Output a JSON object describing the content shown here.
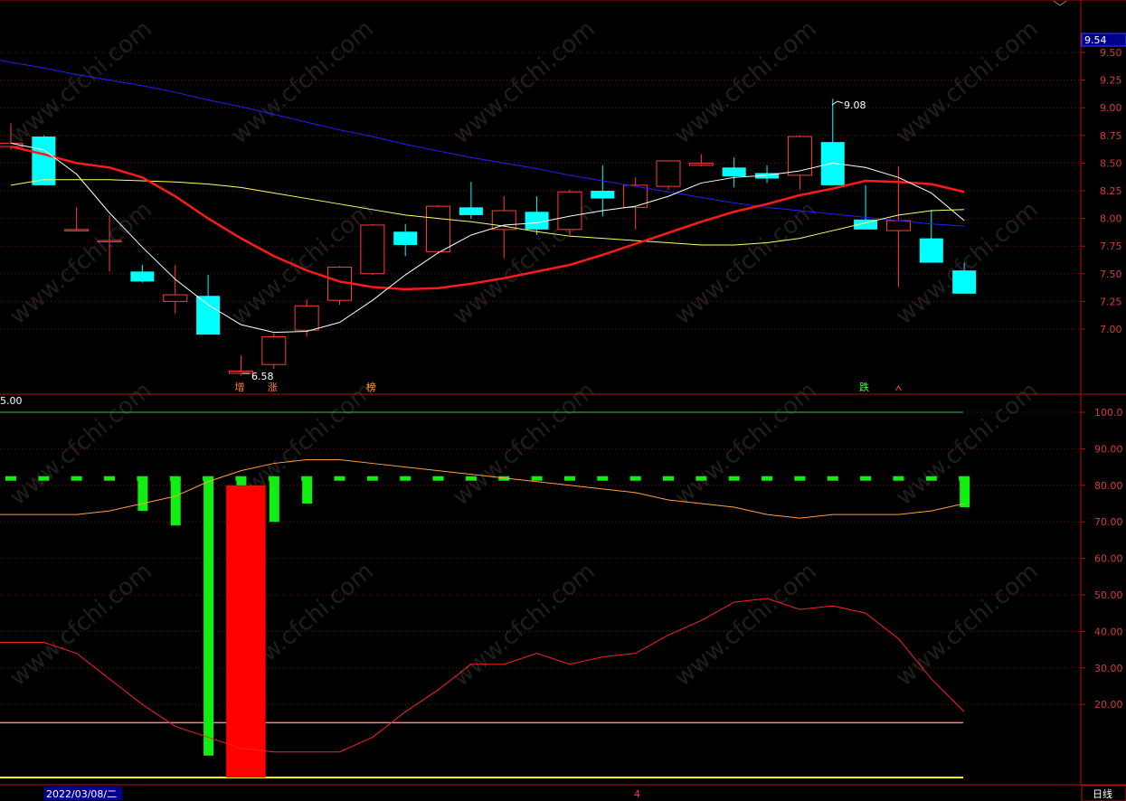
{
  "colors": {
    "background": "#000000",
    "axis": "#b01010",
    "grid": "#7a1010",
    "up": "#ff3c3c",
    "down": "#00ffff",
    "ma_short": "#ffffff",
    "ma_mid": "#ff1a1a",
    "ma_long": "#ffff66",
    "ma_longest": "#2020ff",
    "green_bar": "#11ee11",
    "red_bar": "#ff0000",
    "orange_line": "#ffa040",
    "red_line": "#ff2020",
    "ref_line_pink": "#ff8080",
    "ref_line_yellow": "#ffff00",
    "ref_line_green": "#3cbc3c",
    "price_tag_bg": "#00008b"
  },
  "header": {
    "price_tag": "9.54",
    "left_label": "5.00"
  },
  "footer": {
    "date_label": "2022/03/08/二",
    "center_marker": "4",
    "period_label": "日线"
  },
  "annotations": {
    "high_label": "9.08",
    "low_label": "6.58"
  },
  "chart_data": [
    {
      "type": "candlestick",
      "ylim": [
        6.7,
        9.6
      ],
      "yticks": [
        "9.50",
        "9.25",
        "9.00",
        "8.75",
        "8.50",
        "8.25",
        "8.00",
        "7.75",
        "7.50",
        "7.25",
        "7.00"
      ],
      "ytick_values": [
        9.5,
        9.25,
        9.0,
        8.75,
        8.5,
        8.25,
        8.0,
        7.75,
        7.5,
        7.25,
        7.0
      ],
      "candles": [
        {
          "o": 8.65,
          "h": 8.86,
          "l": 8.62,
          "c": 8.68
        },
        {
          "o": 8.74,
          "h": 8.75,
          "l": 8.3,
          "c": 8.3
        },
        {
          "o": 7.9,
          "h": 8.1,
          "l": 7.88,
          "c": 7.9
        },
        {
          "o": 7.8,
          "h": 8.03,
          "l": 7.52,
          "c": 7.8
        },
        {
          "o": 7.52,
          "h": 7.58,
          "l": 7.42,
          "c": 7.43
        },
        {
          "o": 7.25,
          "h": 7.58,
          "l": 7.14,
          "c": 7.31
        },
        {
          "o": 7.3,
          "h": 7.49,
          "l": 6.95,
          "c": 6.95
        },
        {
          "o": 6.6,
          "h": 6.76,
          "l": 6.58,
          "c": 6.62
        },
        {
          "o": 6.68,
          "h": 6.96,
          "l": 6.64,
          "c": 6.93
        },
        {
          "o": 6.99,
          "h": 7.27,
          "l": 6.93,
          "c": 7.21
        },
        {
          "o": 7.26,
          "h": 7.57,
          "l": 7.22,
          "c": 7.56
        },
        {
          "o": 7.5,
          "h": 7.95,
          "l": 7.49,
          "c": 7.94
        },
        {
          "o": 7.88,
          "h": 7.95,
          "l": 7.66,
          "c": 7.76
        },
        {
          "o": 7.7,
          "h": 8.12,
          "l": 7.69,
          "c": 8.11
        },
        {
          "o": 8.1,
          "h": 8.33,
          "l": 8.0,
          "c": 8.03
        },
        {
          "o": 7.9,
          "h": 8.2,
          "l": 7.64,
          "c": 8.07
        },
        {
          "o": 8.06,
          "h": 8.2,
          "l": 7.85,
          "c": 7.9
        },
        {
          "o": 7.9,
          "h": 8.26,
          "l": 7.85,
          "c": 8.24
        },
        {
          "o": 8.25,
          "h": 8.48,
          "l": 8.02,
          "c": 8.18
        },
        {
          "o": 8.1,
          "h": 8.37,
          "l": 7.9,
          "c": 8.3
        },
        {
          "o": 8.29,
          "h": 8.52,
          "l": 8.26,
          "c": 8.52
        },
        {
          "o": 8.48,
          "h": 8.58,
          "l": 8.47,
          "c": 8.5
        },
        {
          "o": 8.46,
          "h": 8.55,
          "l": 8.28,
          "c": 8.38
        },
        {
          "o": 8.41,
          "h": 8.48,
          "l": 8.32,
          "c": 8.36
        },
        {
          "o": 8.39,
          "h": 8.75,
          "l": 8.26,
          "c": 8.74
        },
        {
          "o": 8.69,
          "h": 9.08,
          "l": 8.3,
          "c": 8.3
        },
        {
          "o": 7.99,
          "h": 8.3,
          "l": 7.9,
          "c": 7.9
        },
        {
          "o": 7.89,
          "h": 8.47,
          "l": 7.38,
          "c": 7.98
        },
        {
          "o": 7.82,
          "h": 8.08,
          "l": 7.6,
          "c": 7.6
        },
        {
          "o": 7.53,
          "h": 7.6,
          "l": 7.32,
          "c": 7.32
        }
      ],
      "ma_short": [
        8.68,
        8.62,
        8.4,
        8.05,
        7.74,
        7.45,
        7.22,
        7.04,
        6.97,
        6.98,
        7.06,
        7.26,
        7.49,
        7.69,
        7.85,
        7.94,
        7.96,
        8.02,
        8.07,
        8.11,
        8.2,
        8.32,
        8.37,
        8.39,
        8.43,
        8.5,
        8.46,
        8.37,
        8.23,
        7.98
      ],
      "ma_mid": [
        8.65,
        8.58,
        8.5,
        8.46,
        8.37,
        8.2,
        8.0,
        7.82,
        7.66,
        7.53,
        7.43,
        7.38,
        7.36,
        7.37,
        7.41,
        7.46,
        7.52,
        7.58,
        7.67,
        7.77,
        7.87,
        7.97,
        8.06,
        8.13,
        8.21,
        8.27,
        8.34,
        8.33,
        8.31,
        8.24
      ],
      "ma_long": [
        8.3,
        8.35,
        8.35,
        8.35,
        8.34,
        8.33,
        8.31,
        8.28,
        8.23,
        8.18,
        8.13,
        8.08,
        8.03,
        8.0,
        7.97,
        7.93,
        7.88,
        7.84,
        7.82,
        7.8,
        7.78,
        7.76,
        7.76,
        7.78,
        7.82,
        7.89,
        7.96,
        8.03,
        8.07,
        8.08
      ],
      "ma_longest": [
        9.41,
        9.36,
        9.3,
        9.25,
        9.2,
        9.14,
        9.07,
        9.01,
        8.94,
        8.87,
        8.8,
        8.74,
        8.67,
        8.61,
        8.55,
        8.5,
        8.45,
        8.39,
        8.34,
        8.29,
        8.24,
        8.19,
        8.14,
        8.1,
        8.07,
        8.04,
        8.01,
        7.98,
        7.95,
        7.93
      ],
      "signals": [
        {
          "index": 7,
          "label": "增",
          "color": "#ff8040"
        },
        {
          "index": 8,
          "label": "涨",
          "color": "#ff8040"
        },
        {
          "index": 11,
          "label": "榜",
          "color": "#ffb040"
        },
        {
          "index": 26,
          "label": "跌",
          "color": "#40ff40"
        }
      ]
    },
    {
      "type": "indicator",
      "ylim": [
        0,
        105
      ],
      "yticks": [
        "100.0",
        "90.00",
        "80.00",
        "70.00",
        "60.00",
        "50.00",
        "40.00",
        "30.00",
        "20.00"
      ],
      "ytick_values": [
        100,
        90,
        80,
        70,
        60,
        50,
        40,
        30,
        20
      ],
      "ref_lines": {
        "green": 100,
        "pink": 15,
        "yellow": 0
      },
      "dash_level": 82,
      "green_bars": [
        {
          "index": 4,
          "top": 82,
          "bottom": 73
        },
        {
          "index": 5,
          "top": 82,
          "bottom": 69
        },
        {
          "index": 6,
          "top": 82,
          "bottom": 6
        },
        {
          "index": 7,
          "top": 82,
          "bottom": 80
        },
        {
          "index": 8,
          "top": 82,
          "bottom": 70
        },
        {
          "index": 9,
          "top": 82,
          "bottom": 75
        },
        {
          "index": 29,
          "top": 82,
          "bottom": 74
        }
      ],
      "red_bar": {
        "index_start": 6.55,
        "index_end": 7.75,
        "top": 80,
        "bottom": 0
      },
      "orange_line": [
        72,
        72,
        72,
        73,
        75,
        77,
        81,
        84,
        86,
        87,
        87,
        86,
        85,
        84,
        83,
        82,
        81,
        80,
        79,
        78,
        76,
        75,
        74,
        72,
        71,
        72,
        72,
        72,
        73,
        75
      ],
      "red_line": [
        37,
        37,
        34,
        27,
        20,
        14,
        11,
        8,
        7,
        7,
        7,
        11,
        18,
        24,
        31,
        31,
        34,
        31,
        33,
        34,
        39,
        43,
        48,
        49,
        46,
        47,
        45,
        38,
        27,
        18
      ]
    }
  ]
}
